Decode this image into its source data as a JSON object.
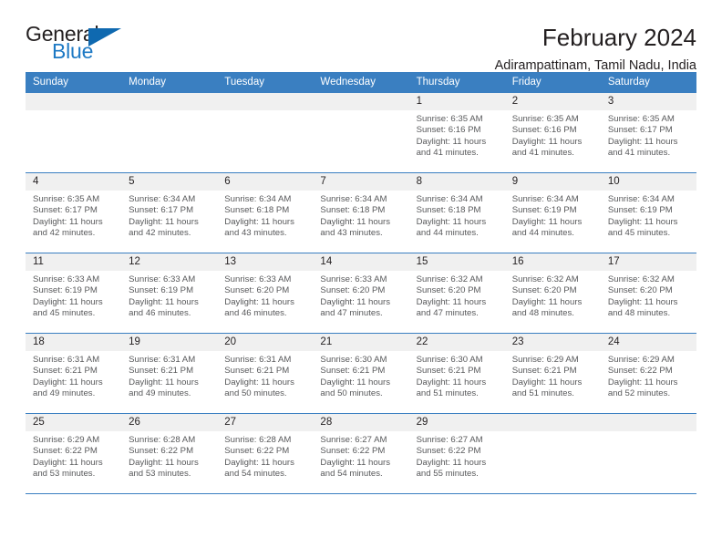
{
  "brand": {
    "name_top": "General",
    "name_bottom": "Blue",
    "accent_color": "#1d79c4",
    "triangle_color": "#0f69b0"
  },
  "header": {
    "title": "February 2024",
    "location": "Adirampattinam, Tamil Nadu, India"
  },
  "calendar": {
    "header_bg": "#3a7fc1",
    "daynum_bg": "#f0f0f0",
    "weekday_headers": [
      "Sunday",
      "Monday",
      "Tuesday",
      "Wednesday",
      "Thursday",
      "Friday",
      "Saturday"
    ],
    "weeks": [
      [
        {
          "day": "",
          "lines": []
        },
        {
          "day": "",
          "lines": []
        },
        {
          "day": "",
          "lines": []
        },
        {
          "day": "",
          "lines": []
        },
        {
          "day": "1",
          "lines": [
            "Sunrise: 6:35 AM",
            "Sunset: 6:16 PM",
            "Daylight: 11 hours",
            "and 41 minutes."
          ]
        },
        {
          "day": "2",
          "lines": [
            "Sunrise: 6:35 AM",
            "Sunset: 6:16 PM",
            "Daylight: 11 hours",
            "and 41 minutes."
          ]
        },
        {
          "day": "3",
          "lines": [
            "Sunrise: 6:35 AM",
            "Sunset: 6:17 PM",
            "Daylight: 11 hours",
            "and 41 minutes."
          ]
        }
      ],
      [
        {
          "day": "4",
          "lines": [
            "Sunrise: 6:35 AM",
            "Sunset: 6:17 PM",
            "Daylight: 11 hours",
            "and 42 minutes."
          ]
        },
        {
          "day": "5",
          "lines": [
            "Sunrise: 6:34 AM",
            "Sunset: 6:17 PM",
            "Daylight: 11 hours",
            "and 42 minutes."
          ]
        },
        {
          "day": "6",
          "lines": [
            "Sunrise: 6:34 AM",
            "Sunset: 6:18 PM",
            "Daylight: 11 hours",
            "and 43 minutes."
          ]
        },
        {
          "day": "7",
          "lines": [
            "Sunrise: 6:34 AM",
            "Sunset: 6:18 PM",
            "Daylight: 11 hours",
            "and 43 minutes."
          ]
        },
        {
          "day": "8",
          "lines": [
            "Sunrise: 6:34 AM",
            "Sunset: 6:18 PM",
            "Daylight: 11 hours",
            "and 44 minutes."
          ]
        },
        {
          "day": "9",
          "lines": [
            "Sunrise: 6:34 AM",
            "Sunset: 6:19 PM",
            "Daylight: 11 hours",
            "and 44 minutes."
          ]
        },
        {
          "day": "10",
          "lines": [
            "Sunrise: 6:34 AM",
            "Sunset: 6:19 PM",
            "Daylight: 11 hours",
            "and 45 minutes."
          ]
        }
      ],
      [
        {
          "day": "11",
          "lines": [
            "Sunrise: 6:33 AM",
            "Sunset: 6:19 PM",
            "Daylight: 11 hours",
            "and 45 minutes."
          ]
        },
        {
          "day": "12",
          "lines": [
            "Sunrise: 6:33 AM",
            "Sunset: 6:19 PM",
            "Daylight: 11 hours",
            "and 46 minutes."
          ]
        },
        {
          "day": "13",
          "lines": [
            "Sunrise: 6:33 AM",
            "Sunset: 6:20 PM",
            "Daylight: 11 hours",
            "and 46 minutes."
          ]
        },
        {
          "day": "14",
          "lines": [
            "Sunrise: 6:33 AM",
            "Sunset: 6:20 PM",
            "Daylight: 11 hours",
            "and 47 minutes."
          ]
        },
        {
          "day": "15",
          "lines": [
            "Sunrise: 6:32 AM",
            "Sunset: 6:20 PM",
            "Daylight: 11 hours",
            "and 47 minutes."
          ]
        },
        {
          "day": "16",
          "lines": [
            "Sunrise: 6:32 AM",
            "Sunset: 6:20 PM",
            "Daylight: 11 hours",
            "and 48 minutes."
          ]
        },
        {
          "day": "17",
          "lines": [
            "Sunrise: 6:32 AM",
            "Sunset: 6:20 PM",
            "Daylight: 11 hours",
            "and 48 minutes."
          ]
        }
      ],
      [
        {
          "day": "18",
          "lines": [
            "Sunrise: 6:31 AM",
            "Sunset: 6:21 PM",
            "Daylight: 11 hours",
            "and 49 minutes."
          ]
        },
        {
          "day": "19",
          "lines": [
            "Sunrise: 6:31 AM",
            "Sunset: 6:21 PM",
            "Daylight: 11 hours",
            "and 49 minutes."
          ]
        },
        {
          "day": "20",
          "lines": [
            "Sunrise: 6:31 AM",
            "Sunset: 6:21 PM",
            "Daylight: 11 hours",
            "and 50 minutes."
          ]
        },
        {
          "day": "21",
          "lines": [
            "Sunrise: 6:30 AM",
            "Sunset: 6:21 PM",
            "Daylight: 11 hours",
            "and 50 minutes."
          ]
        },
        {
          "day": "22",
          "lines": [
            "Sunrise: 6:30 AM",
            "Sunset: 6:21 PM",
            "Daylight: 11 hours",
            "and 51 minutes."
          ]
        },
        {
          "day": "23",
          "lines": [
            "Sunrise: 6:29 AM",
            "Sunset: 6:21 PM",
            "Daylight: 11 hours",
            "and 51 minutes."
          ]
        },
        {
          "day": "24",
          "lines": [
            "Sunrise: 6:29 AM",
            "Sunset: 6:22 PM",
            "Daylight: 11 hours",
            "and 52 minutes."
          ]
        }
      ],
      [
        {
          "day": "25",
          "lines": [
            "Sunrise: 6:29 AM",
            "Sunset: 6:22 PM",
            "Daylight: 11 hours",
            "and 53 minutes."
          ]
        },
        {
          "day": "26",
          "lines": [
            "Sunrise: 6:28 AM",
            "Sunset: 6:22 PM",
            "Daylight: 11 hours",
            "and 53 minutes."
          ]
        },
        {
          "day": "27",
          "lines": [
            "Sunrise: 6:28 AM",
            "Sunset: 6:22 PM",
            "Daylight: 11 hours",
            "and 54 minutes."
          ]
        },
        {
          "day": "28",
          "lines": [
            "Sunrise: 6:27 AM",
            "Sunset: 6:22 PM",
            "Daylight: 11 hours",
            "and 54 minutes."
          ]
        },
        {
          "day": "29",
          "lines": [
            "Sunrise: 6:27 AM",
            "Sunset: 6:22 PM",
            "Daylight: 11 hours",
            "and 55 minutes."
          ]
        },
        {
          "day": "",
          "lines": []
        },
        {
          "day": "",
          "lines": []
        }
      ]
    ]
  }
}
